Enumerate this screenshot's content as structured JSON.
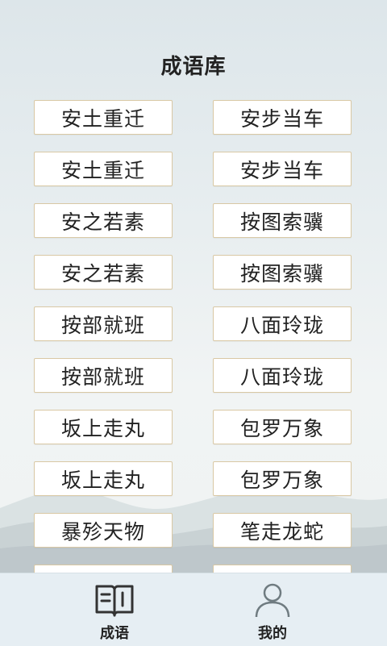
{
  "header": {
    "title": "成语库"
  },
  "idioms": [
    "安土重迁",
    "安步当车",
    "安土重迁",
    "安步当车",
    "安之若素",
    "按图索骥",
    "安之若素",
    "按图索骥",
    "按部就班",
    "八面玲珑",
    "按部就班",
    "八面玲珑",
    "坂上走丸",
    "包罗万象",
    "坂上走丸",
    "包罗万象",
    "暴殄天物",
    "笔走龙蛇",
    "",
    ""
  ],
  "tabbar": {
    "tabs": [
      {
        "label": "成语",
        "icon": "book-icon"
      },
      {
        "label": "我的",
        "icon": "user-icon"
      }
    ]
  },
  "colors": {
    "button_border": "#d9c8a4",
    "tabbar_bg": "#e6eef3",
    "icon": "#333333"
  }
}
